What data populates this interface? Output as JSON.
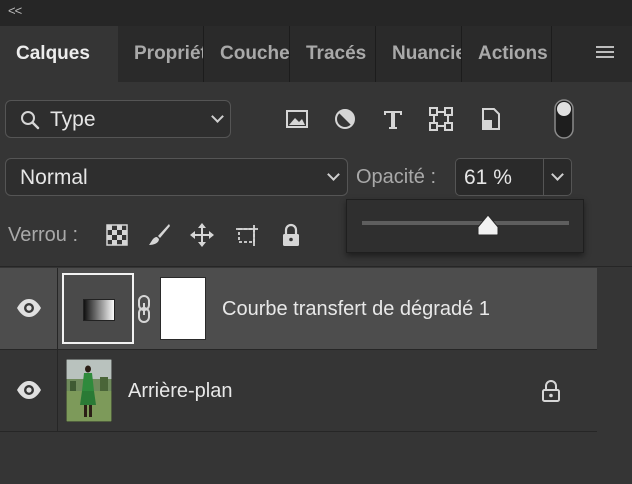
{
  "panel": {
    "collapse_glyph": "<<",
    "menu_icon": "hamburger-icon"
  },
  "tabs": [
    {
      "label": "Calques",
      "active": true
    },
    {
      "label": "Propriétés",
      "active": false
    },
    {
      "label": "Couches",
      "active": false
    },
    {
      "label": "Tracés",
      "active": false
    },
    {
      "label": "Nuancier",
      "active": false
    },
    {
      "label": "Actions",
      "active": false
    }
  ],
  "filter": {
    "value": "Type",
    "icons": [
      "search-icon",
      "chevron-down-icon"
    ],
    "type_icons": [
      "image-filter-icon",
      "adjustment-filter-icon",
      "type-filter-icon",
      "shape-filter-icon",
      "smart-object-filter-icon",
      "filter-toggle-icon"
    ]
  },
  "blend": {
    "mode": "Normal",
    "opacity_label": "Opacité :",
    "opacity_value": "61 %",
    "opacity_percent": 61
  },
  "lock": {
    "label": "Verrou :",
    "icons": [
      "lock-transparent-pixels-icon",
      "lock-image-pixels-icon",
      "lock-position-icon",
      "lock-artboard-icon",
      "lock-all-icon"
    ]
  },
  "layers": [
    {
      "name": "Courbe transfert de dégradé 1",
      "visible": true,
      "selected": true,
      "type": "gradient-map-adjustment"
    },
    {
      "name": "Arrière-plan",
      "visible": true,
      "selected": false,
      "locked": true,
      "type": "background"
    }
  ],
  "colors": {
    "panel_bg": "#353535",
    "tabbar_bg": "#2a2a2a",
    "selected_row": "#4d4d4d",
    "text": "#e8e8e8",
    "muted_text": "#a9a9a9"
  }
}
